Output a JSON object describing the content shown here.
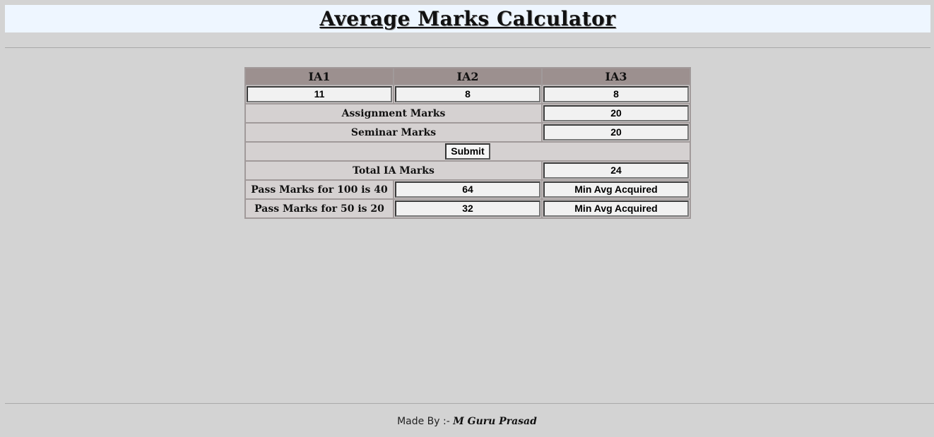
{
  "header": {
    "title": "Average Marks Calculator"
  },
  "table": {
    "headers": [
      "IA1",
      "IA2",
      "IA3"
    ],
    "ia_values": [
      "11",
      "8",
      "8"
    ],
    "assignment_label": "Assignment Marks",
    "assignment_value": "20",
    "seminar_label": "Seminar Marks",
    "seminar_value": "20",
    "submit_label": "Submit",
    "total_label": "Total IA Marks",
    "total_value": "24",
    "pass100_label": "Pass Marks for 100 is 40",
    "pass100_value": "64",
    "pass100_status": "Min Avg Acquired",
    "pass50_label": "Pass Marks for 50 is 20",
    "pass50_value": "32",
    "pass50_status": "Min Avg Acquired"
  },
  "footer": {
    "prefix": "Made By :- ",
    "author": "M Guru Prasad"
  }
}
